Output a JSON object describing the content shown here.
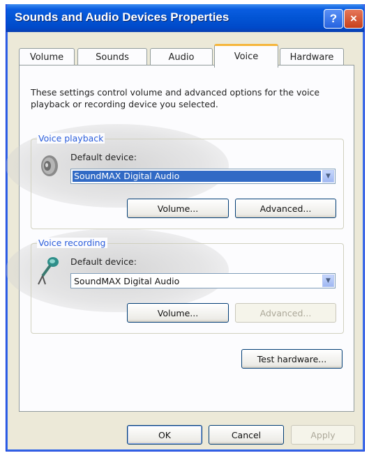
{
  "window": {
    "title": "Sounds and Audio Devices Properties",
    "help_glyph": "?",
    "close_glyph": "×"
  },
  "tabs": [
    {
      "label": "Volume",
      "active": false
    },
    {
      "label": "Sounds",
      "active": false
    },
    {
      "label": "Audio",
      "active": false
    },
    {
      "label": "Voice",
      "active": true
    },
    {
      "label": "Hardware",
      "active": false
    }
  ],
  "description": "These settings control volume and advanced options for the voice playback or recording device you selected.",
  "playback": {
    "group_label": "Voice playback",
    "device_label": "Default device:",
    "device_value": "SoundMAX Digital Audio",
    "volume_button": "Volume...",
    "advanced_button": "Advanced...",
    "icon": "speaker-icon"
  },
  "recording": {
    "group_label": "Voice recording",
    "device_label": "Default device:",
    "device_value": "SoundMAX Digital Audio",
    "volume_button": "Volume...",
    "advanced_button": "Advanced...",
    "icon": "microphone-icon"
  },
  "test_hardware_button": "Test hardware...",
  "footer": {
    "ok": "OK",
    "cancel": "Cancel",
    "apply": "Apply"
  },
  "colors": {
    "titlebar": "#0254d4",
    "selection": "#316ac5",
    "group_label": "#2a5ddb",
    "active_tab_accent": "#f5b53a"
  }
}
